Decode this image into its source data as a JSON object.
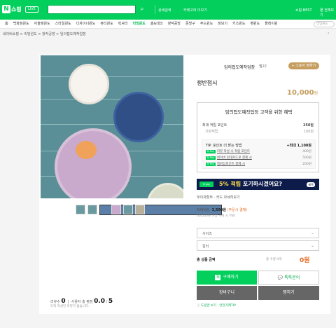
{
  "header": {
    "logo_letter": "N",
    "logo_text": "쇼핑",
    "live_badge": "LIVE",
    "search_icon": "search-icon",
    "detail_search": "상세검색",
    "category_nav": "카테고리 더보기",
    "shopping_best": "쇼핑 BEST",
    "partner_link": "쿨 전체보기"
  },
  "categories": [
    "홈",
    "백화점윈도",
    "아울렛윈도",
    "스타일윈도",
    "디자이너윈도",
    "뷰티윈도",
    "럭셔리",
    "리빙윈도",
    "홈&데코",
    "창작공방",
    "문방구",
    "푸드윈도",
    "장보기",
    "키즈윈도",
    "펫윈도",
    "플레이윈"
  ],
  "active_category": "리빙윈도",
  "category_dropdown": "리빙윈도",
  "breadcrumb": "네이버쇼핑 > 리빙윈도 > 창작공방 > 임의접도예작업장",
  "store": {
    "name": "임의접도예작업장",
    "zzim_label": "찜22",
    "store_button": "+ 스토어 찜하기"
  },
  "product": {
    "name": "쟁반접시",
    "price": "10,000",
    "price_unit": "원"
  },
  "benefit": {
    "heading": "임의접도예작업장 고객을 위한 혜택",
    "max_points_label": "최대 적립 포인트",
    "max_points_value": "250원",
    "basic_label": "기본적립",
    "basic_value": "100원",
    "tip_title": "TIP. 포인트 더 받는 방법",
    "tip_total": "+최대 1,100원",
    "tips": [
      {
        "tag": "N Pay",
        "text": "리뷰 작성 시 적립 포인트",
        "amount": "400원"
      },
      {
        "tag": "N Pay",
        "text": "네이버 현대카드로 결제 시",
        "amount": "500원"
      },
      {
        "tag": "N Pay",
        "text": "멤버십포인트 결제 시",
        "amount": "200원"
      }
    ]
  },
  "ad_banner": {
    "logo": "N pay",
    "text_highlight": "5% 적립",
    "text": "포기하시겠어요?",
    "arrow": "혜택"
  },
  "payment": "무이자할부 · 카드 자세히보기",
  "shipping": {
    "label": "택배배송",
    "fee": "3,500원",
    "condition": "(주문시 결제)",
    "note": "60,000원 이상 구매 시 무료"
  },
  "options": [
    {
      "label": "사이즈"
    },
    {
      "label": "컬러"
    }
  ],
  "total": {
    "label": "총 상품 금액",
    "qty": "총 수량 0개",
    "value": "0원"
  },
  "buttons": {
    "buy": "구매하기",
    "talk": "톡톡문의",
    "cart": "장바구니",
    "zzim": "찜하기"
  },
  "safety": "도움말 보기 · 안전거래TIP",
  "reviews": {
    "count_label": "리뷰수",
    "count": "0",
    "rating_label": "사용자 총 평점",
    "rating": "0.0",
    "rating_max": "5",
    "empty_note": "아직 작성된 리뷰가 없습니다."
  },
  "colors": {
    "brand": "#03cf5d",
    "accent": "#c59d5f",
    "orange": "#e46b24"
  }
}
